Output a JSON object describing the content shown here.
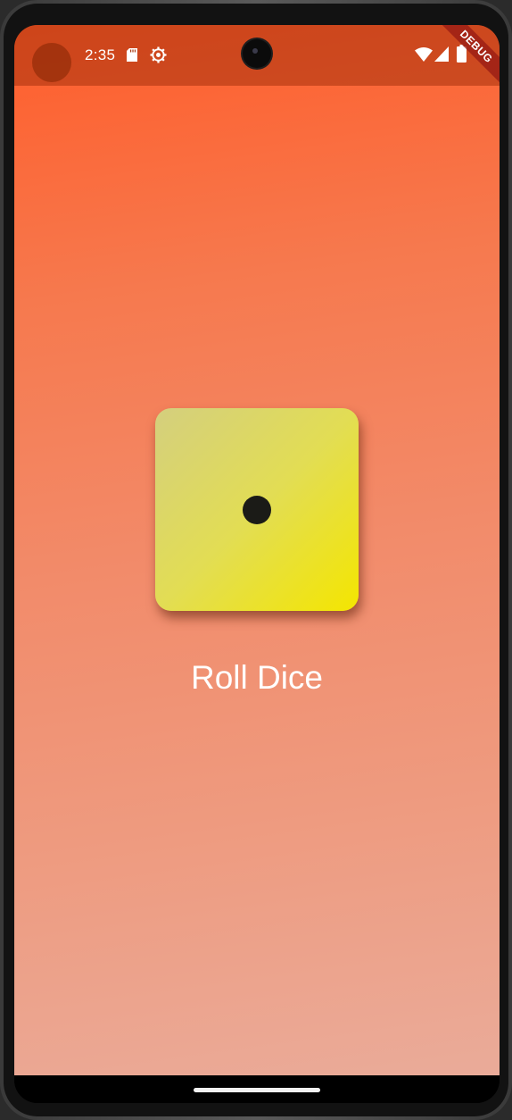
{
  "status_bar": {
    "time": "2:35",
    "icons": [
      "sd-card-icon",
      "gear-icon",
      "wifi-icon",
      "cellular-signal-icon",
      "battery-icon"
    ]
  },
  "debug_banner": {
    "label": "DEBUG"
  },
  "dice": {
    "face_value": 1,
    "pip_count": 1
  },
  "roll_button": {
    "label": "Roll Dice"
  },
  "colors": {
    "gradient_top": "#ff5d2b",
    "gradient_bottom": "#eaab99",
    "dice_light": "#d4cf7e",
    "dice_bright": "#f4e600",
    "pip": "#1b1b17",
    "text": "#ffffff"
  }
}
